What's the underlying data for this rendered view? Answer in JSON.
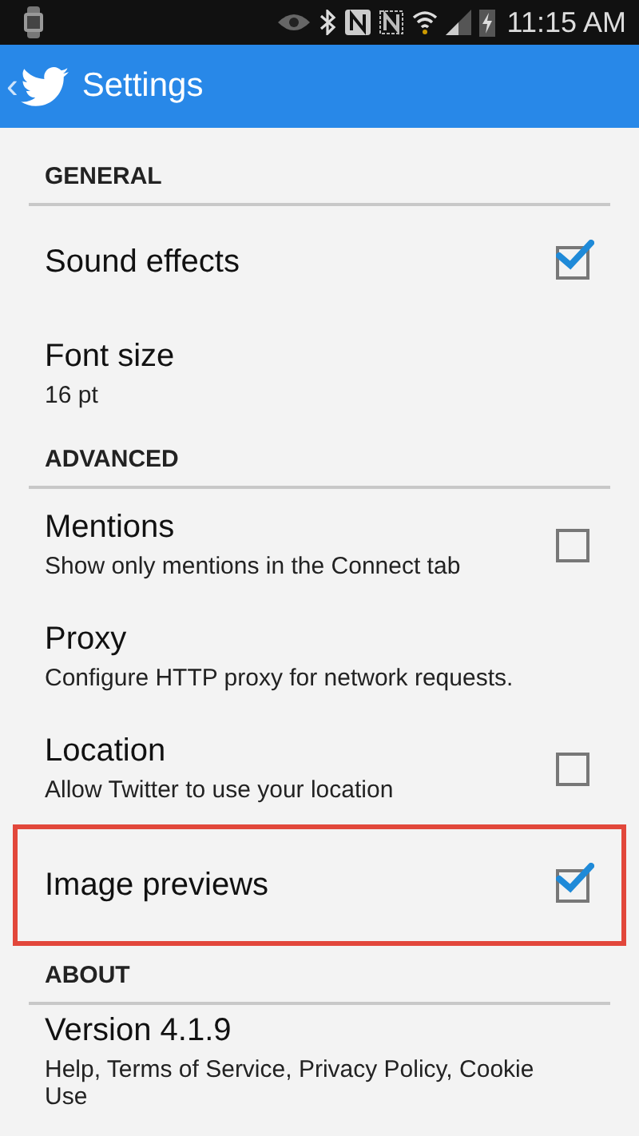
{
  "status_bar": {
    "time": "11:15 AM"
  },
  "action_bar": {
    "back": "‹",
    "title": "Settings"
  },
  "sections": [
    {
      "header": "GENERAL",
      "items": [
        {
          "kind": "checkbox",
          "title": "Sound effects",
          "checked": true,
          "highlighted": false
        },
        {
          "kind": "plain",
          "title": "Font size",
          "summary": "16 pt",
          "highlighted": false
        }
      ]
    },
    {
      "header": "ADVANCED",
      "items": [
        {
          "kind": "checkbox",
          "title": "Mentions",
          "summary": "Show only mentions in the Connect tab",
          "checked": false,
          "highlighted": false
        },
        {
          "kind": "plain",
          "title": "Proxy",
          "summary": "Configure HTTP proxy for network requests.",
          "highlighted": false
        },
        {
          "kind": "checkbox",
          "title": "Location",
          "summary": "Allow Twitter to use your location",
          "checked": false,
          "highlighted": false
        },
        {
          "kind": "checkbox",
          "title": "Image previews",
          "checked": true,
          "highlighted": true
        }
      ]
    },
    {
      "header": "ABOUT",
      "items": [
        {
          "kind": "plain",
          "title": "Version 4.1.9",
          "summary": "Help, Terms of Service, Privacy Policy, Cookie Use",
          "highlighted": false
        }
      ]
    }
  ]
}
